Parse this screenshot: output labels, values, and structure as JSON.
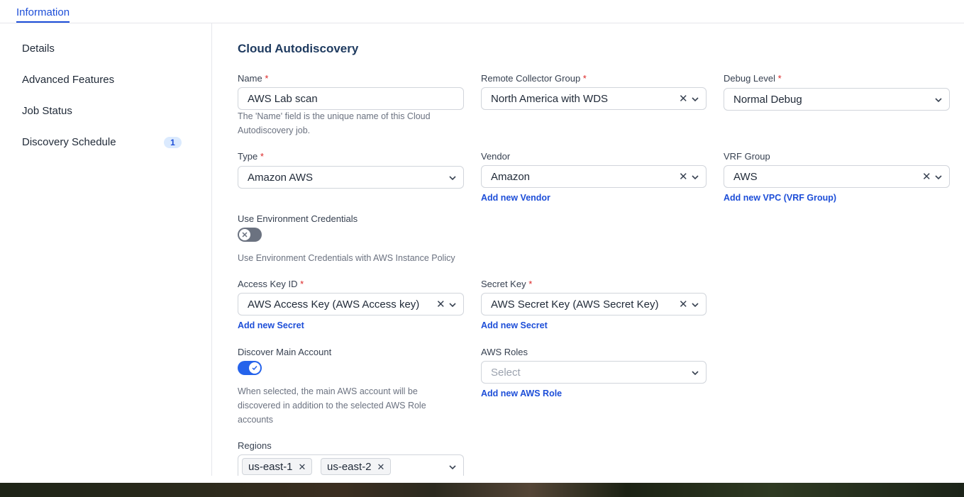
{
  "tabs": {
    "active": "Information"
  },
  "sidebar": {
    "items": [
      {
        "label": "Details"
      },
      {
        "label": "Advanced Features"
      },
      {
        "label": "Job Status"
      },
      {
        "label": "Discovery Schedule",
        "badge": "1"
      }
    ]
  },
  "form": {
    "title": "Cloud Autodiscovery",
    "name": {
      "label": "Name",
      "required": "*",
      "value": "AWS Lab scan",
      "help": "The 'Name' field is the unique name of this Cloud Autodiscovery job."
    },
    "remote_collector_group": {
      "label": "Remote Collector Group",
      "required": "*",
      "value": "North America with WDS"
    },
    "debug_level": {
      "label": "Debug Level",
      "required": "*",
      "value": "Normal Debug"
    },
    "type": {
      "label": "Type",
      "required": "*",
      "value": "Amazon AWS"
    },
    "vendor": {
      "label": "Vendor",
      "value": "Amazon",
      "add_link": "Add new Vendor"
    },
    "vrf_group": {
      "label": "VRF Group",
      "value": "AWS",
      "add_link": "Add new VPC (VRF Group)"
    },
    "use_env_credentials": {
      "label": "Use Environment Credentials",
      "enabled": false,
      "help": "Use Environment Credentials with AWS Instance Policy"
    },
    "access_key_id": {
      "label": "Access Key ID",
      "required": "*",
      "value": "AWS Access Key (AWS Access key)",
      "add_link": "Add new Secret"
    },
    "secret_key": {
      "label": "Secret Key",
      "required": "*",
      "value": "AWS Secret Key (AWS Secret Key)",
      "add_link": "Add new Secret"
    },
    "discover_main_account": {
      "label": "Discover Main Account",
      "enabled": true,
      "help": "When selected, the main AWS account will be discovered in addition to the selected AWS Role accounts"
    },
    "aws_roles": {
      "label": "AWS Roles",
      "placeholder": "Select",
      "add_link": "Add new AWS Role"
    },
    "regions": {
      "label": "Regions",
      "values": [
        "us-east-1",
        "us-east-2"
      ]
    }
  },
  "icons": {
    "clear": "close-icon",
    "dropdown": "chevron-down-icon",
    "toggle_off": "x-icon",
    "toggle_on": "check-icon"
  },
  "colors": {
    "accent": "#1d4ed8",
    "required": "#dc2626",
    "title": "#1e3a5f"
  }
}
